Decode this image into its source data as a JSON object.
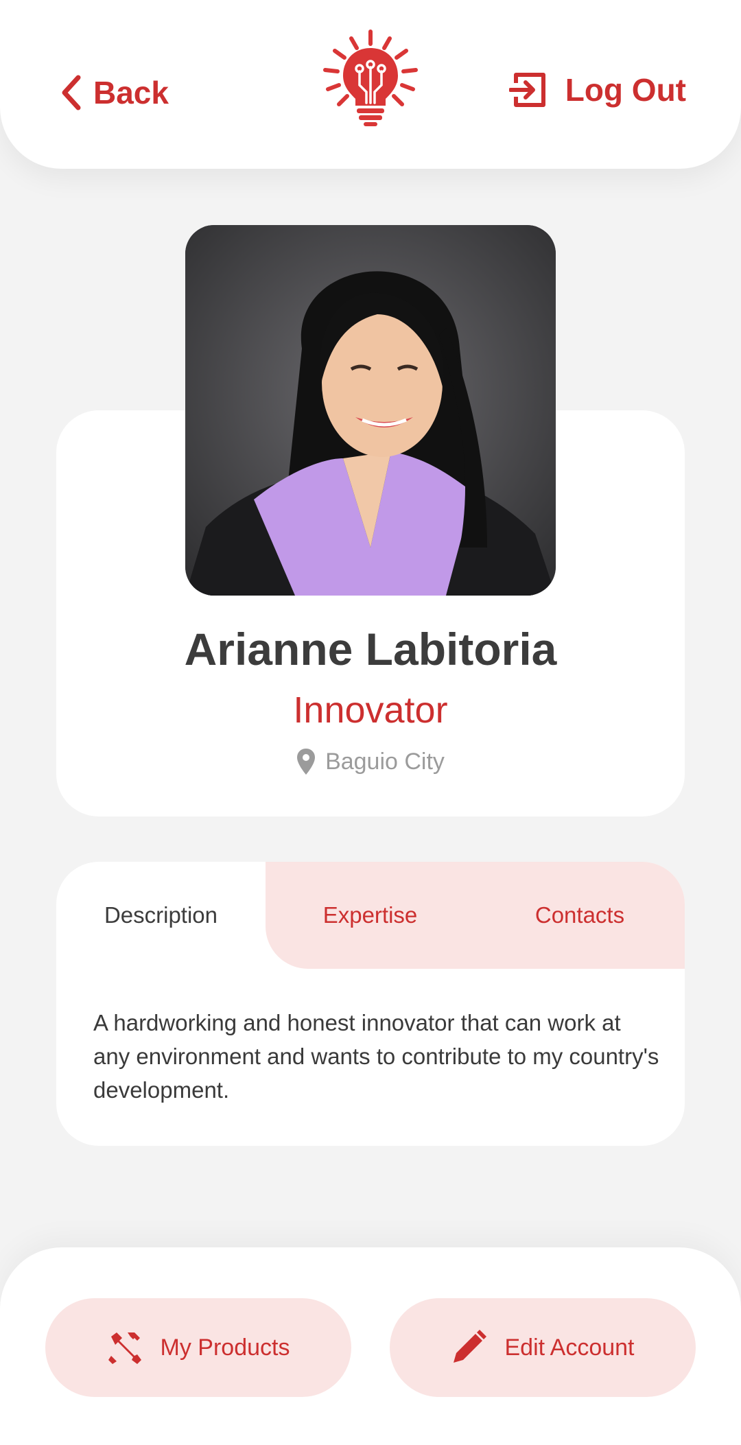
{
  "header": {
    "back_label": "Back",
    "logout_label": "Log Out",
    "logo_icon": "lightbulb-circuit-icon"
  },
  "profile": {
    "name": "Arianne Labitoria",
    "role": "Innovator",
    "location": "Baguio City",
    "photo": "profile-photo"
  },
  "tabs": {
    "items": [
      "Description",
      "Expertise",
      "Contacts"
    ],
    "active": "Description",
    "description_text": "A hardworking and honest innovator that can work at any environment and wants to contribute to my country's development."
  },
  "actions": {
    "products_label": "My Products",
    "edit_label": "Edit Account",
    "products_icon": "tools-icon",
    "edit_icon": "pencil-icon"
  },
  "colors": {
    "accent": "#cc2f2f",
    "accent_soft": "#fae4e3",
    "background": "#f3f3f3",
    "text_dark": "#3c3c3c",
    "text_muted": "#9b9b9b"
  }
}
